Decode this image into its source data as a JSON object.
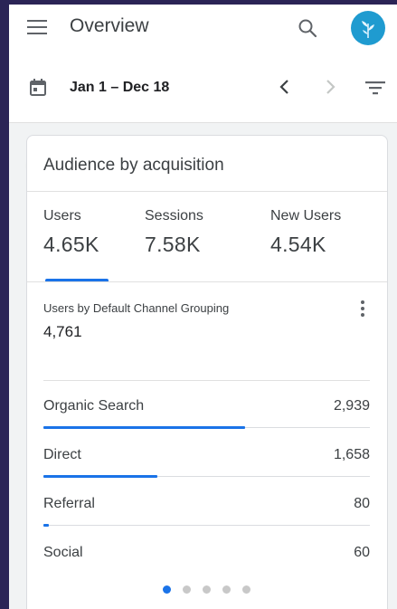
{
  "header": {
    "title": "Overview",
    "menu_icon": "hamburger-menu-icon",
    "search_icon": "search-icon",
    "avatar_icon": "plant-avatar-icon"
  },
  "date_bar": {
    "range": "Jan 1 – Dec 18",
    "calendar_icon": "calendar-icon",
    "prev_icon": "chevron-left-icon",
    "next_icon": "chevron-right-icon",
    "filter_icon": "filter-icon"
  },
  "card": {
    "title": "Audience by acquisition",
    "metrics": [
      {
        "label": "Users",
        "value": "4.65K",
        "selected": true
      },
      {
        "label": "Sessions",
        "value": "7.58K",
        "selected": false
      },
      {
        "label": "New Users",
        "value": "4.54K",
        "selected": false
      }
    ],
    "breakdown": {
      "title": "Users by Default Channel Grouping",
      "total": "4,761",
      "more_icon": "more-vert-icon",
      "rows": [
        {
          "name": "Organic Search",
          "count": "2,939",
          "fraction": 0.617
        },
        {
          "name": "Direct",
          "count": "1,658",
          "fraction": 0.348
        },
        {
          "name": "Referral",
          "count": "80",
          "fraction": 0.017
        },
        {
          "name": "Social",
          "count": "60",
          "fraction": 0.0
        }
      ]
    },
    "pagination": {
      "count": 5,
      "active": 0
    }
  },
  "colors": {
    "accent": "#1a73e8",
    "frame": "#2b2456",
    "avatar": "#1f9bd0"
  }
}
